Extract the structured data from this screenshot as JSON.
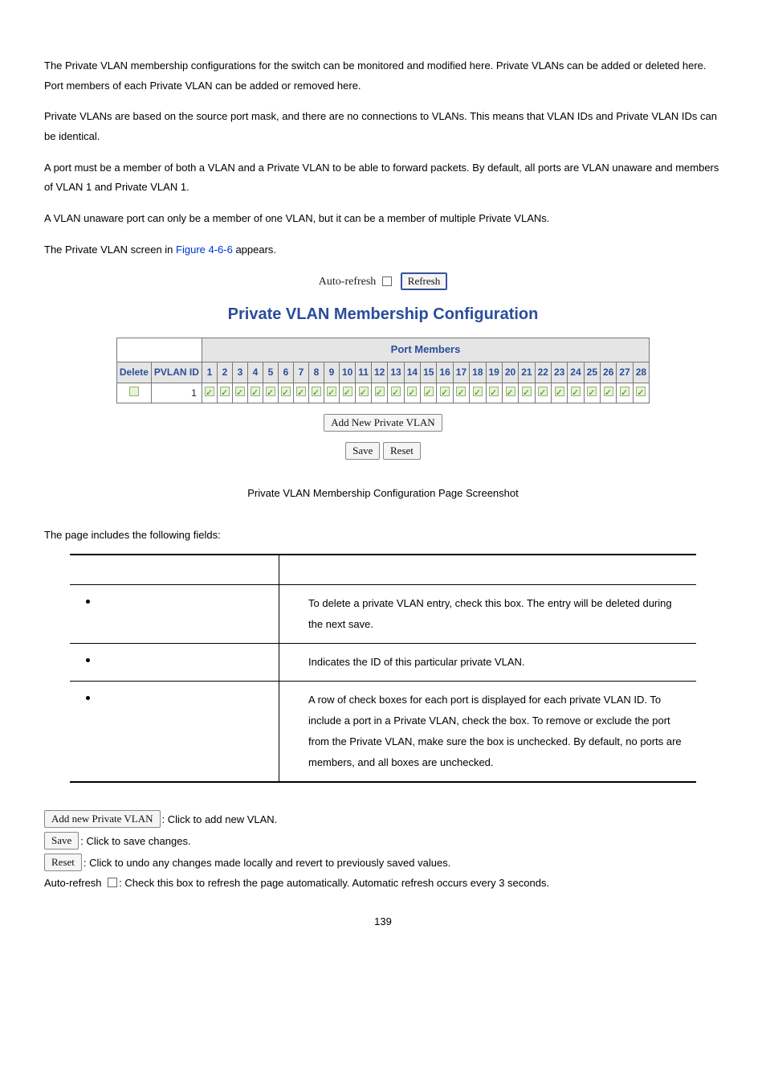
{
  "intro": {
    "p1": "The Private VLAN membership configurations for the switch can be monitored and modified here. Private VLANs can be added or deleted here. Port members of each Private VLAN can be added or removed here.",
    "p2": "Private VLANs are based on the source port mask, and there are no connections to VLANs. This means that VLAN IDs and Private VLAN IDs can be identical.",
    "p3": "A port must be a member of both a VLAN and a Private VLAN to be able to forward packets. By default, all ports are VLAN unaware and members of VLAN 1 and Private VLAN 1.",
    "p4": "A VLAN unaware port can only be a member of one VLAN, but it can be a member of multiple Private VLANs.",
    "p5_a": "The Private VLAN screen in ",
    "p5_link": "Figure 4-6-6",
    "p5_b": " appears."
  },
  "toolbelt": {
    "auto_refresh_label": "Auto-refresh",
    "refresh_label": "Refresh"
  },
  "section_title": "Private VLAN Membership Configuration",
  "table": {
    "port_members_header": "Port Members",
    "col_delete": "Delete",
    "col_pvlanid": "PVLAN ID",
    "ports": [
      "1",
      "2",
      "3",
      "4",
      "5",
      "6",
      "7",
      "8",
      "9",
      "10",
      "11",
      "12",
      "13",
      "14",
      "15",
      "16",
      "17",
      "18",
      "19",
      "20",
      "21",
      "22",
      "23",
      "24",
      "25",
      "26",
      "27",
      "28"
    ],
    "row_pvlanid_value": "1"
  },
  "buttons": {
    "add_new": "Add New Private VLAN",
    "save": "Save",
    "reset": "Reset"
  },
  "caption": "Private VLAN Membership Configuration Page Screenshot",
  "fields_intro": "The page includes the following fields:",
  "fields": {
    "d1": "To delete a private VLAN entry, check this box. The entry will be deleted during the next save.",
    "d2": "Indicates the ID of this particular private VLAN.",
    "d3": "A row of check boxes for each port is displayed for each private VLAN ID. To include a port in a Private VLAN, check the box. To remove or exclude the port from the Private VLAN, make sure the box is unchecked. By default, no ports are members, and all boxes are unchecked."
  },
  "legend": {
    "add_btn": "Add new Private VLAN",
    "add_txt": ": Click to add new VLAN.",
    "save_btn": "Save",
    "save_txt": ": Click to save changes.",
    "reset_btn": "Reset",
    "reset_txt": ": Click to undo any changes made locally and revert to previously saved values.",
    "ar_label": "Auto-refresh",
    "ar_txt": ": Check this box to refresh the page automatically. Automatic refresh occurs every 3 seconds."
  },
  "page_number": "139"
}
